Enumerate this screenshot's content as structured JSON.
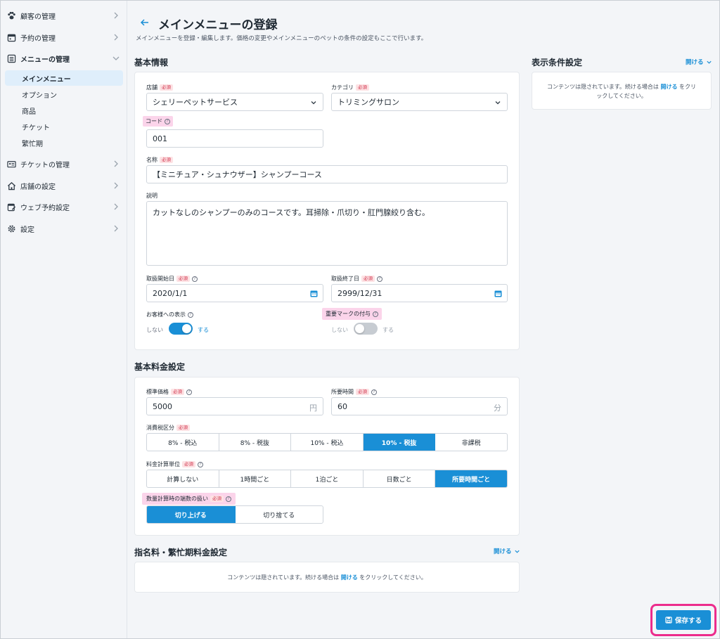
{
  "sidebar": {
    "items": [
      {
        "label": "顧客の管理"
      },
      {
        "label": "予約の管理"
      },
      {
        "label": "メニューの管理"
      },
      {
        "label": "チケットの管理"
      },
      {
        "label": "店舗の設定"
      },
      {
        "label": "ウェブ予約設定"
      },
      {
        "label": "設定"
      }
    ],
    "sub_items": [
      {
        "label": "メインメニュー"
      },
      {
        "label": "オプション"
      },
      {
        "label": "商品"
      },
      {
        "label": "チケット"
      },
      {
        "label": "繁忙期"
      }
    ]
  },
  "header": {
    "title": "メインメニューの登録",
    "description": "メインメニューを登録・編集します。価格の変更やメインメニューのペットの条件の設定もここで行います。"
  },
  "basic_info": {
    "title": "基本情報",
    "store_label": "店舗",
    "store_value": "シェリーペットサービス",
    "category_label": "カテゴリ",
    "category_value": "トリミングサロン",
    "code_label": "コード",
    "code_value": "001",
    "name_label": "名称",
    "name_value": "【ミニチュア・シュナウザー】シャンプーコース",
    "desc_label": "説明",
    "desc_value": "カットなしのシャンプーのみのコースです。耳掃除・爪切り・肛門腺絞り含む。",
    "start_label": "取扱開始日",
    "start_value": "2020/1/1",
    "end_label": "取扱終了日",
    "end_value": "2999/12/31",
    "display_label": "お客様への表示",
    "display_off": "しない",
    "display_on": "する",
    "display_enabled": true,
    "mark_label": "重要マークの付与",
    "mark_off": "しない",
    "mark_on": "する",
    "mark_enabled": false
  },
  "required_text": "必須",
  "price": {
    "title": "基本料金設定",
    "std_label": "標準価格",
    "std_value": "5000",
    "std_unit": "円",
    "time_label": "所要時間",
    "time_value": "60",
    "time_unit": "分",
    "tax_label": "消費税区分",
    "tax_options": [
      "8% - 税込",
      "8% - 税抜",
      "10% - 税込",
      "10% - 税抜",
      "非課税"
    ],
    "tax_selected": 3,
    "unit_label": "料金計算単位",
    "unit_options": [
      "計算しない",
      "1時間ごと",
      "1泊ごと",
      "日数ごと",
      "所要時間ごと"
    ],
    "unit_selected": 4,
    "round_label": "数量計算時の端数の扱い",
    "round_options": [
      "切り上げる",
      "切り捨てる"
    ],
    "round_selected": 0
  },
  "nomination": {
    "title": "指名料・繁忙期料金設定",
    "open_label": "開ける",
    "msg_before": "コンテンツは隠されています。続ける場合は",
    "msg_link": "開ける",
    "msg_after": "をクリックしてください。"
  },
  "display_cond": {
    "title": "表示条件設定",
    "open_label": "開ける",
    "msg_before": "コンテンツは隠されています。続ける場合は",
    "msg_link": "開ける",
    "msg_after_1": "をクリ",
    "msg_after_2": "ックしてください。"
  },
  "save_label": "保存する",
  "colors": {
    "accent": "#1a8fd6",
    "highlight": "#fbd4ea",
    "save_outline": "#ec2c8c"
  }
}
